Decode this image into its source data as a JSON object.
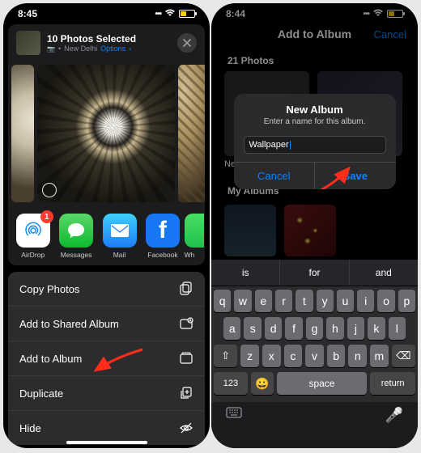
{
  "left": {
    "status": {
      "time": "8:45"
    },
    "share": {
      "title": "10 Photos Selected",
      "location_icon": "📷",
      "location": "New Delhi",
      "options": "Options",
      "chev": "›"
    },
    "apps": {
      "airdrop": {
        "label": "AirDrop",
        "badge": "1"
      },
      "messages": {
        "label": "Messages"
      },
      "mail": {
        "label": "Mail"
      },
      "facebook": {
        "label": "Facebook",
        "glyph": "f"
      },
      "whatsapp": {
        "label": "Wh"
      }
    },
    "actions": {
      "copy": "Copy Photos",
      "shared": "Add to Shared Album",
      "album": "Add to Album",
      "duplicate": "Duplicate",
      "hide": "Hide"
    }
  },
  "right": {
    "status": {
      "time": "8:44"
    },
    "nav": {
      "title": "Add to Album",
      "cancel": "Cancel"
    },
    "count_label": "21 Photos",
    "new_album_label": "New Album...",
    "my_albums_label": "My Albums",
    "dialog": {
      "title": "New Album",
      "message": "Enter a name for this album.",
      "input_value": "Wallpaper",
      "cancel": "Cancel",
      "save": "Save"
    },
    "suggestions": [
      "is",
      "for",
      "and"
    ],
    "keyboard": {
      "row1": [
        "q",
        "w",
        "e",
        "r",
        "t",
        "y",
        "u",
        "i",
        "o",
        "p"
      ],
      "row2": [
        "a",
        "s",
        "d",
        "f",
        "g",
        "h",
        "j",
        "k",
        "l"
      ],
      "row3": [
        "z",
        "x",
        "c",
        "v",
        "b",
        "n",
        "m"
      ],
      "shift": "⇧",
      "del": "⌫",
      "numkey": "123",
      "emoji": "😀",
      "space": "space",
      "ret": "return",
      "mic": "🎤"
    }
  }
}
